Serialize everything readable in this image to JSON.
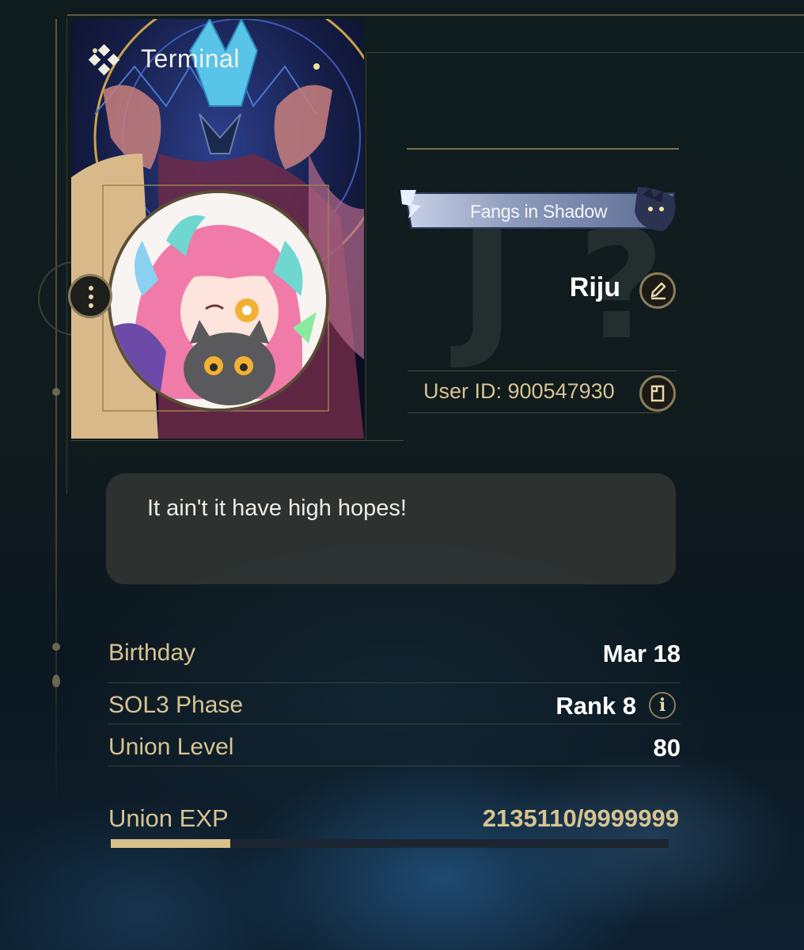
{
  "card": {
    "title": "Terminal",
    "logo_icon": "diamond-cluster-icon",
    "menu_icon": "vertical-dots-icon"
  },
  "profile": {
    "badge": "Fangs in Shadow",
    "name": "Riju",
    "edit_icon": "pencil-icon",
    "user_id": "User ID: 900547930",
    "copy_icon": "copy-icon",
    "bio": "It ain't it have high hopes!"
  },
  "stats": {
    "birthday": {
      "label": "Birthday",
      "value": "Mar 18"
    },
    "phase": {
      "label": "SOL3 Phase",
      "value": "Rank 8",
      "info_icon": "info-icon"
    },
    "union_level": {
      "label": "Union Level",
      "value": "80"
    },
    "union_exp": {
      "label": "Union EXP",
      "value": "2135110/9999999",
      "progress": 0.2135
    }
  },
  "colors": {
    "gold": "#d7c391",
    "accent_border": "#8a7d5a",
    "bar_fill": "#d8c08b"
  }
}
